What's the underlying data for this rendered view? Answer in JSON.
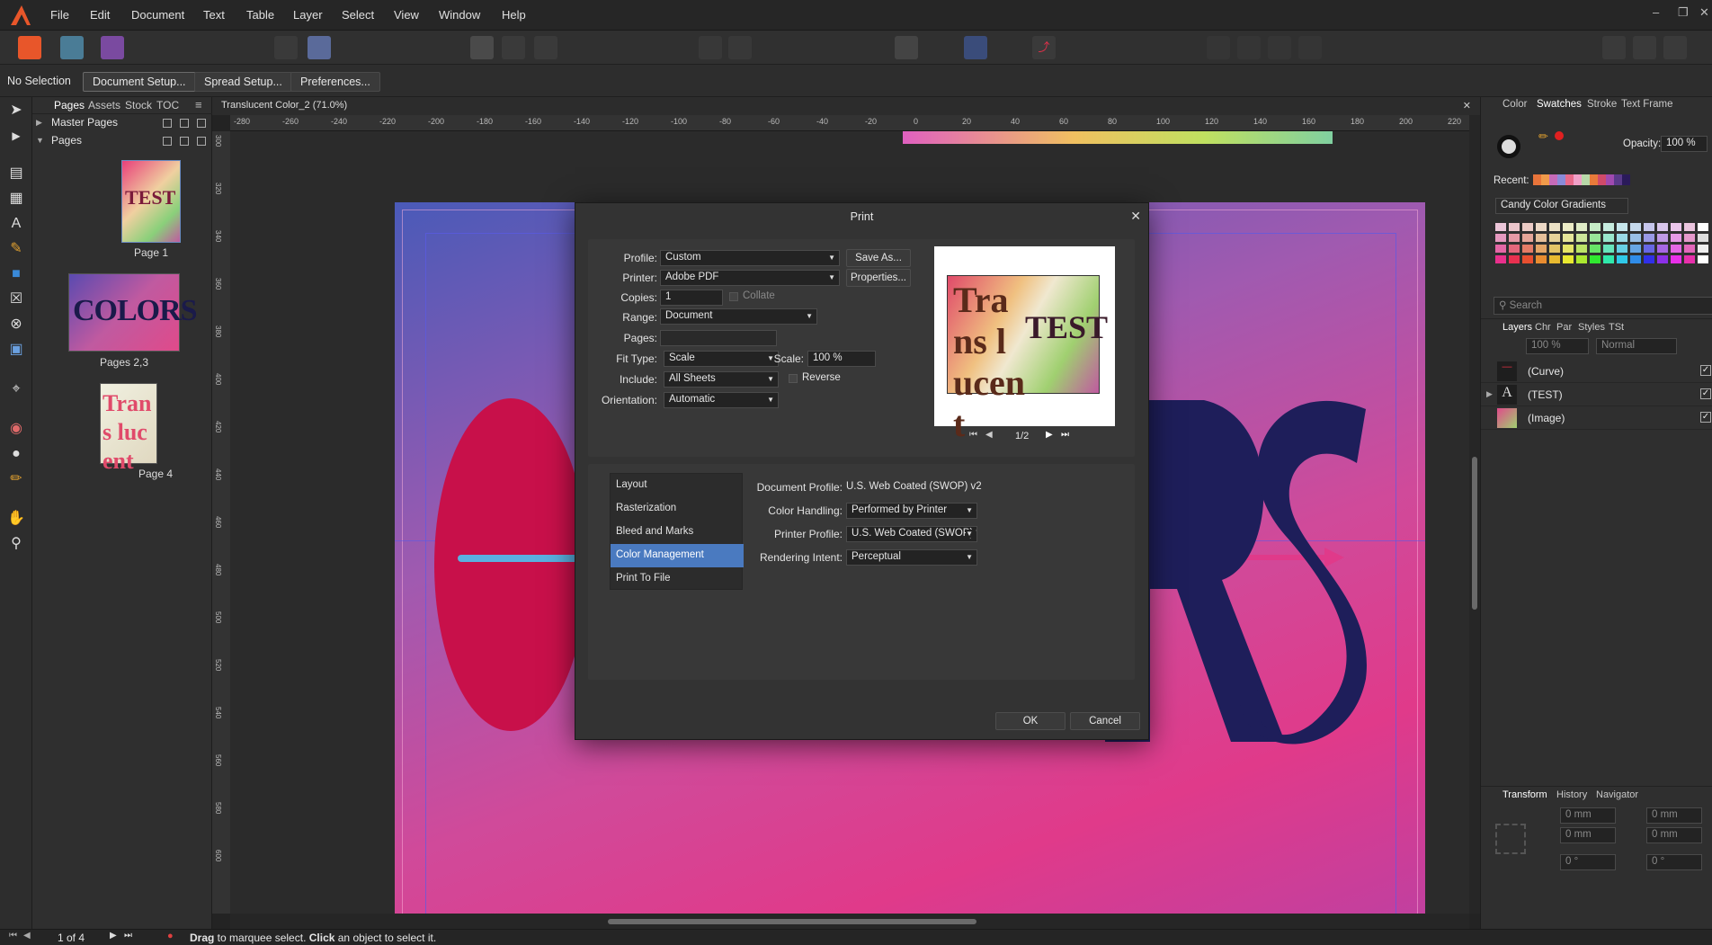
{
  "menubar": {
    "items": [
      "File",
      "Edit",
      "Document",
      "Text",
      "Table",
      "Layer",
      "Select",
      "View",
      "Window",
      "Help"
    ]
  },
  "context_bar": {
    "selection": "No Selection",
    "buttons": [
      "Document Setup...",
      "Spread Setup...",
      "Preferences..."
    ]
  },
  "pages_panel": {
    "tabs": [
      "Pages",
      "Assets",
      "Stock",
      "TOC"
    ],
    "master_pages": "Master Pages",
    "pages": "Pages",
    "thumbs": [
      {
        "label": "Page 1",
        "text": "TEST"
      },
      {
        "label": "Pages 2,3",
        "text": "COLORS"
      },
      {
        "label": "Page 4",
        "text": "Trans lucent"
      }
    ]
  },
  "document": {
    "tab_title": "Translucent Color_2 (71.0%)",
    "ruler_ticks": [
      "-280",
      "-260",
      "-240",
      "-220",
      "-200",
      "-180",
      "-160",
      "-140",
      "-120",
      "-100",
      "-80",
      "-60",
      "-40",
      "-20",
      "0",
      "20",
      "40",
      "60",
      "80",
      "100",
      "120",
      "140",
      "160",
      "180",
      "200",
      "220"
    ],
    "vruler_ticks": [
      "300",
      "320",
      "340",
      "360",
      "380",
      "400",
      "420",
      "440",
      "460",
      "480",
      "500",
      "520",
      "540",
      "560",
      "580",
      "600"
    ]
  },
  "dialog": {
    "title": "Print",
    "profile_label": "Profile:",
    "profile_value": "Custom",
    "save_as": "Save As...",
    "printer_label": "Printer:",
    "printer_value": "Adobe PDF",
    "properties": "Properties...",
    "copies_label": "Copies:",
    "copies_value": "1",
    "collate": "Collate",
    "range_label": "Range:",
    "range_value": "Document",
    "pages_label": "Pages:",
    "fit_label": "Fit Type:",
    "fit_value": "Scale",
    "scale_label": "Scale:",
    "scale_value": "100 %",
    "include_label": "Include:",
    "include_value": "All Sheets",
    "reverse": "Reverse",
    "orientation_label": "Orientation:",
    "orientation_value": "Automatic",
    "preview_page": "1/2",
    "preview_text_a": "Trans lucent",
    "preview_text_b": "TEST",
    "nav": [
      "Layout",
      "Rasterization",
      "Bleed and Marks",
      "Color Management",
      "Print To File"
    ],
    "selected_nav": 3,
    "doc_profile_label": "Document Profile:",
    "doc_profile_value": "U.S. Web Coated (SWOP) v2",
    "color_handling_label": "Color Handling:",
    "color_handling_value": "Performed by Printer",
    "printer_profile_label": "Printer Profile:",
    "printer_profile_value": "U.S. Web Coated (SWOP) v",
    "rendering_intent_label": "Rendering Intent:",
    "rendering_intent_value": "Perceptual",
    "ok": "OK",
    "cancel": "Cancel"
  },
  "right_panel": {
    "tabs": [
      "Color",
      "Swatches",
      "Stroke",
      "Text Frame"
    ],
    "opacity_label": "Opacity:",
    "opacity_value": "100 %",
    "recent_label": "Recent:",
    "palette_name": "Candy Color Gradients",
    "search_placeholder": "Search",
    "layers_tabs": [
      "Layers",
      "Chr",
      "Par",
      "Styles",
      "TSt"
    ],
    "layer_opacity": "100 %",
    "blend_mode": "Normal",
    "layers": [
      "(Curve)",
      "(TEST)",
      "(Image)"
    ],
    "transform_tabs": [
      "Transform",
      "History",
      "Navigator"
    ],
    "transform_fields": {
      "x": "0 mm",
      "y": "0 mm",
      "w": "0 mm",
      "h": "0 mm",
      "r": "0 °",
      "s": "0 °"
    },
    "colors": {
      "accent": "#4a7ac0",
      "recent": [
        "#e8743a",
        "#f09a4a",
        "#c66ab8",
        "#8a8ad8",
        "#e86a8a",
        "#f0a0c8",
        "#b8d8a8",
        "#e87a3a",
        "#d04a6a",
        "#a04ab0",
        "#5a3a8a",
        "#2a1a5a"
      ]
    }
  },
  "status": {
    "page": "1 of 4",
    "hint_drag": "Drag",
    "hint_mid": " to marquee select. ",
    "hint_click": "Click",
    "hint_end": " an object to select it."
  }
}
